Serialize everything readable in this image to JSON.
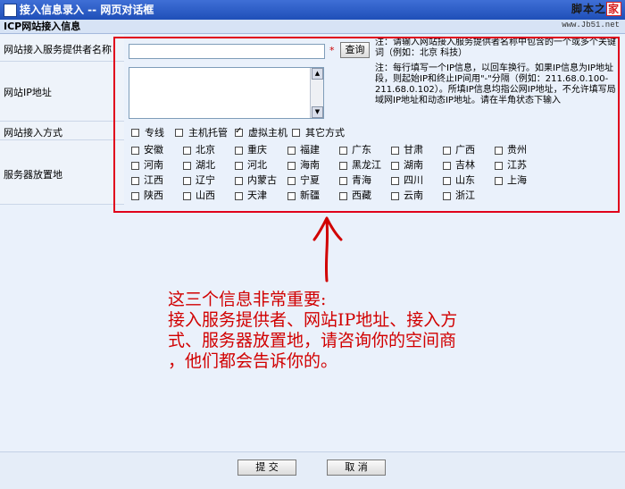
{
  "window": {
    "title": "接入信息录入 -- 网页对话框",
    "logo_text": "脚本之",
    "logo_box": "家",
    "logo_url": "www.Jb51.net"
  },
  "section": {
    "title": "ICP网站接入信息"
  },
  "rows": {
    "provider_label": "网站接入服务提供者名称",
    "provider_star": "*",
    "query_button": "查询",
    "provider_note": "注：请输入网站接入服务提供者名称中包含的一个或多个关键词（例如：北京 科技）",
    "ip_label": "网站IP地址",
    "ip_note": "注：每行填写一个IP信息，以回车换行。如果IP信息为IP地址段，则起始IP和终止IP间用\"-\"分隔（例如：211.68.0.100-211.68.0.102）。所填IP信息均指公网IP地址，不允许填写局域网IP地址和动态IP地址。请在半角状态下输入",
    "mode_label": "网站接入方式",
    "location_label": "服务器放置地"
  },
  "modes": [
    {
      "label": "专线",
      "checked": false
    },
    {
      "label": "主机托管",
      "checked": false
    },
    {
      "label": "虚拟主机",
      "checked": true
    },
    {
      "label": "其它方式",
      "checked": false
    }
  ],
  "provinces": [
    [
      "安徽",
      "北京",
      "重庆",
      "福建",
      "广东",
      "甘肃",
      "广西",
      "贵州"
    ],
    [
      "河南",
      "湖北",
      "河北",
      "海南",
      "黑龙江",
      "湖南",
      "吉林",
      "江苏"
    ],
    [
      "江西",
      "辽宁",
      "内蒙古",
      "宁夏",
      "青海",
      "四川",
      "山东",
      "上海"
    ],
    [
      "陕西",
      "山西",
      "天津",
      "新疆",
      "西藏",
      "云南",
      "浙江"
    ]
  ],
  "annotation": {
    "lines": [
      "这三个信息非常重要:",
      "接入服务提供者、网站IP地址、接入方",
      "式、服务器放置地，请咨询你的空间商",
      "，他们都会告诉你的。"
    ],
    "color": "#d10000"
  },
  "footer": {
    "submit": "提 交",
    "cancel": "取 消"
  }
}
